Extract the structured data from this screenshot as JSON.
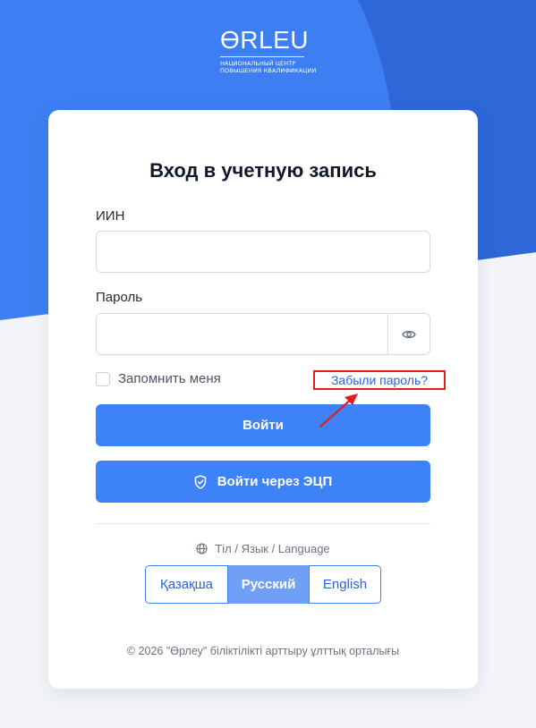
{
  "brand": {
    "logo_word": "ƟRLEU",
    "logo_line1": "НАЦИОНАЛЬНЫЙ ЦЕНТР",
    "logo_line2": "ПОВЫШЕНИЯ КВАЛИФИКАЦИИ"
  },
  "login": {
    "title": "Вход в учетную запись",
    "iin_label": "ИИН",
    "iin_value": "",
    "password_label": "Пароль",
    "password_value": "",
    "remember_label": "Запомнить меня",
    "forgot_label": "Забыли пароль?",
    "login_button": "Войти",
    "ecp_button": "Войти через ЭЦП"
  },
  "language": {
    "title": "Тіл / Язык / Language",
    "options": [
      "Қазақша",
      "Русский",
      "English"
    ],
    "selected": "Русский"
  },
  "footer": {
    "text": "© 2026 \"Өрлеу\" біліктілікті арттыру ұлттық орталығы"
  },
  "icons": {
    "eye": "eye-icon",
    "shield": "shield-check-icon",
    "globe": "globe-icon"
  },
  "colors": {
    "brand_blue": "#3d82f6",
    "dark_blue": "#2f6fe0",
    "highlight_red": "#e11d1d",
    "selected_lang": "#6fa0f5"
  }
}
